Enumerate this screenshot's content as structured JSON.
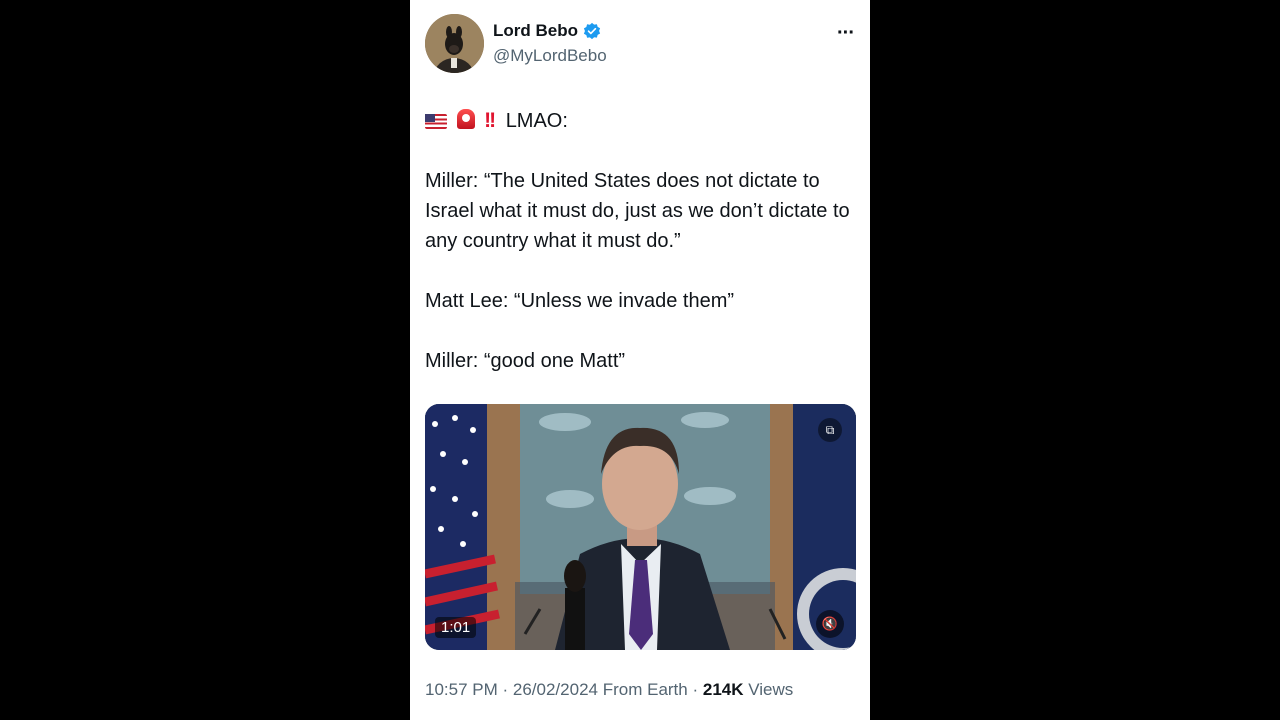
{
  "author": {
    "display_name": "Lord Bebo",
    "handle": "@MyLordBebo",
    "verified": true
  },
  "icons": {
    "verified": "verified-badge-icon",
    "more": "more-options-icon",
    "mute": "speaker-mute-icon",
    "pip": "picture-in-picture-icon"
  },
  "more_label": "···",
  "tweet": {
    "headline_emojis": [
      "flag-us-emoji",
      "police-siren-emoji",
      "double-exclamation-emoji"
    ],
    "headline_text": "LMAO:",
    "paragraphs": [
      "Miller: “The United States does not dictate to Israel what it must do, just as we don’t dictate to any country what it must do.”",
      "Matt Lee: “Unless we invade them”",
      "Miller: “good one Matt”"
    ]
  },
  "video": {
    "duration": "1:01",
    "mute_glyph": "🔇",
    "pip_glyph": "⧉"
  },
  "meta": {
    "time": "10:57 PM",
    "date": "26/02/2024",
    "source": "From Earth",
    "views_count": "214K",
    "views_label": "Views"
  },
  "colors": {
    "verified_blue": "#1d9bf0",
    "text_primary": "#0f1419",
    "text_secondary": "#536471"
  }
}
